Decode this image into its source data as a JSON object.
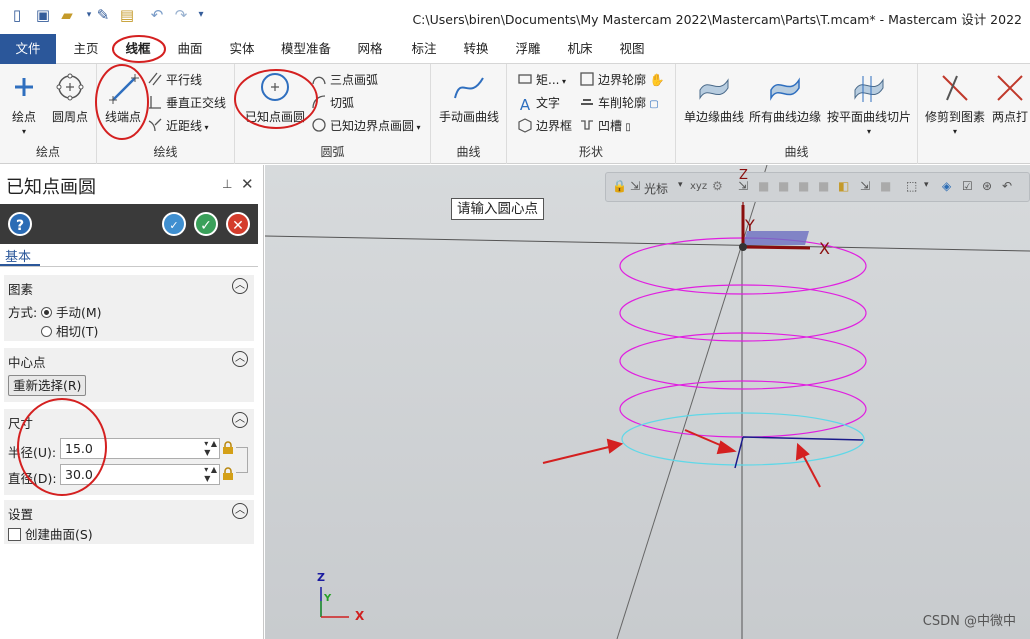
{
  "window": {
    "title": "C:\\Users\\biren\\Documents\\My Mastercam 2022\\Mastercam\\Parts\\T.mcam* - Mastercam 设计 2022"
  },
  "tabs": [
    "文件",
    "主页",
    "线框",
    "曲面",
    "实体",
    "模型准备",
    "网格",
    "标注",
    "转换",
    "浮雕",
    "机床",
    "视图"
  ],
  "ribbon": {
    "draw_points": {
      "label": "绘点",
      "buttons": [
        "绘点",
        "圆周点"
      ]
    },
    "draw_lines": {
      "label": "绘线",
      "buttons": [
        "线端点"
      ],
      "small": [
        "平行线",
        "垂直正交线",
        "近距线"
      ]
    },
    "arcs": {
      "label": "圆弧",
      "buttons": [
        "已知点画圆"
      ],
      "small": [
        "三点画弧",
        "切弧",
        "已知边界点画圆"
      ]
    },
    "curves1": {
      "label": "曲线",
      "buttons": [
        "手动画曲线"
      ]
    },
    "shapes": {
      "label": "形状",
      "small": [
        "矩...",
        "边界轮廓",
        "文字",
        "车削轮廓",
        "边界框",
        "凹槽"
      ]
    },
    "curves2": {
      "label": "曲线",
      "buttons": [
        "单边缘曲线",
        "所有曲线边缘",
        "按平面曲线切片"
      ]
    },
    "modify": {
      "buttons": [
        "修剪到图素",
        "两点打"
      ]
    }
  },
  "panel": {
    "title": "已知点画圆",
    "tab": "基本",
    "entity": {
      "title": "图素",
      "method_label": "方式:",
      "opt1": "手动(M)",
      "opt2": "相切(T)"
    },
    "center": {
      "title": "中心点",
      "reselect": "重新选择(R)"
    },
    "size": {
      "title": "尺寸",
      "radius_label": "半径(U):",
      "radius_value": "15.0",
      "diameter_label": "直径(D):",
      "diameter_value": "30.0"
    },
    "settings": {
      "title": "设置",
      "create_surface": "创建曲面(S)"
    }
  },
  "viewport": {
    "prompt": "请输入圆心点",
    "toolbar_label": "光标",
    "axis_x": "X",
    "axis_y": "Y",
    "axis_z": "Z",
    "watermark": "CSDN @中微中"
  },
  "colors": {
    "accent": "#2b579a",
    "helix": "#e01fe0",
    "circle_cyan": "#5fd8e8",
    "annotation": "#d42020",
    "axis": "#9a0d0d",
    "tool_path": "#1a1a8a"
  }
}
